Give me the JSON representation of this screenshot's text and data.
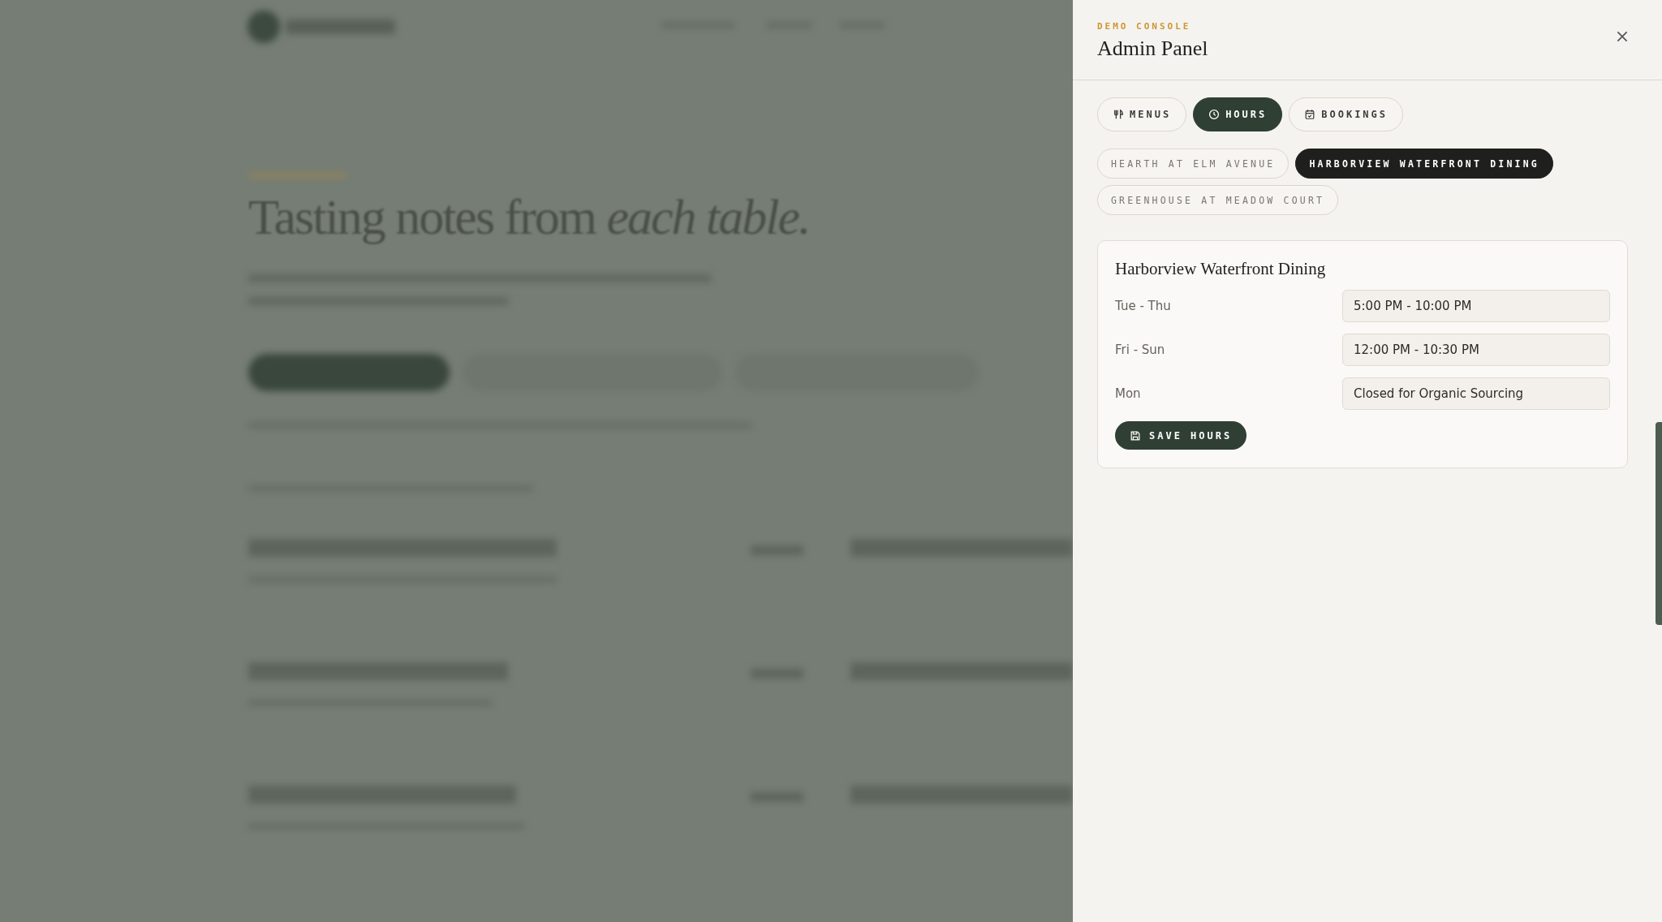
{
  "backdrop": {
    "heading": "Tasting notes from *each table.*"
  },
  "panel": {
    "eyebrow": "DEMO CONSOLE",
    "title": "Admin Panel",
    "tabs": [
      {
        "label": "MENUS",
        "kind": "utensils",
        "selected": false
      },
      {
        "label": "HOURS",
        "kind": "clock",
        "selected": true
      },
      {
        "label": "BOOKINGS",
        "kind": "calendar",
        "selected": false
      }
    ],
    "locations": [
      {
        "label": "HEARTH AT ELM AVENUE",
        "selected": false
      },
      {
        "label": "HARBORVIEW WATERFRONT DINING",
        "selected": true
      },
      {
        "label": "GREENHOUSE AT MEADOW COURT",
        "selected": false
      }
    ],
    "card": {
      "title": "Harborview Waterfront Dining",
      "hours": [
        {
          "days": "Tue - Thu",
          "value": "5:00 PM - 10:00 PM"
        },
        {
          "days": "Fri - Sun",
          "value": "12:00 PM - 10:30 PM"
        },
        {
          "days": "Mon",
          "value": "Closed for Organic Sourcing"
        }
      ],
      "save_button": "SAVE HOURS"
    }
  }
}
